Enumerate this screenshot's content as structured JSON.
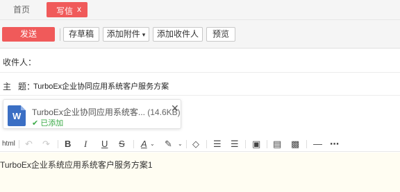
{
  "tabs": {
    "home_label": "首页",
    "write_label": "写信",
    "write_close": "x"
  },
  "toolbar": {
    "send_label": "发送",
    "save_draft_label": "存草稿",
    "add_attachment_label": "添加附件",
    "add_recipient_label": "添加收件人",
    "preview_label": "预览"
  },
  "form": {
    "recipient_label": "收件人：",
    "subject_label": "主   题：",
    "subject_value": "TurboEx企业协同应用系统客户服务方案"
  },
  "attachment": {
    "filename": "TurboEx企业协同应用系统客...",
    "size": "(14.6KB)",
    "status": "已添加",
    "icon_letter": "W",
    "close_glyph": "✕"
  },
  "editor": {
    "html_label": "html",
    "body_text": "TurboEx企业系统应用系统客户服务方案1"
  },
  "colors": {
    "accent": "#f05a5a",
    "success": "#3aaa47",
    "word_blue": "#3b6fc4",
    "editor_bg": "#fffdf2"
  }
}
